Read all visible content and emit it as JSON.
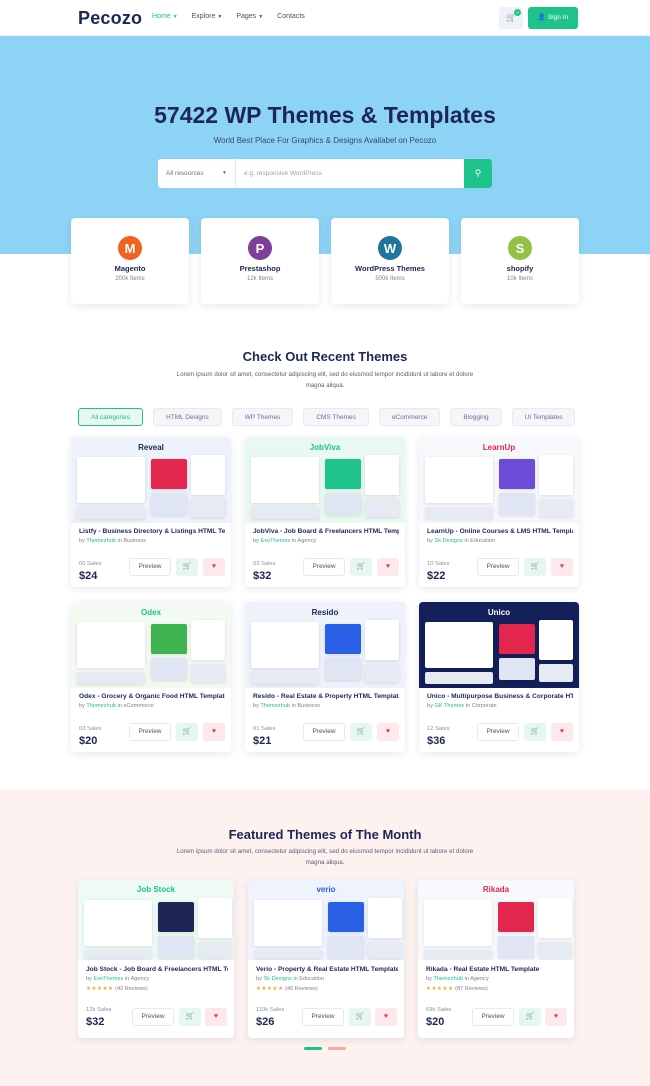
{
  "header": {
    "logo": "Pecozo",
    "nav": [
      {
        "label": "Home",
        "active": true
      },
      {
        "label": "Explore",
        "active": false
      },
      {
        "label": "Pages",
        "active": false
      },
      {
        "label": "Contacts",
        "active": false
      }
    ],
    "cart_count": "0",
    "signin_label": "Sign In"
  },
  "hero": {
    "title": "57422 WP Themes & Templates",
    "subtitle": "World Best Place For Graphics & Designs Availabel on Pecozo",
    "search": {
      "category": "All resources",
      "placeholder": "e.g. responsive WordPress"
    }
  },
  "categories": [
    {
      "name": "Magento",
      "count": "200k Items",
      "icon": "magento-icon",
      "color": "#f26322"
    },
    {
      "name": "Prestashop",
      "count": "12k Items",
      "icon": "prestashop-icon",
      "color": "#7e3f98"
    },
    {
      "name": "WordPress Themes",
      "count": "500k Items",
      "icon": "wordpress-icon",
      "color": "#21759b"
    },
    {
      "name": "shopify",
      "count": "10k Items",
      "icon": "shopify-icon",
      "color": "#95bf47"
    }
  ],
  "recent": {
    "title": "Check Out Recent Themes",
    "description": "Lorem ipsum dolor sit amet, consectetur adipiscing elit, sed do eiusmod tempor incididunt ut labore et dolore magna aliqua.",
    "filters": [
      "All categories",
      "HTML Designs",
      "WP Themes",
      "CMS Themes",
      "eCommerce",
      "Blogging",
      "UI Templates"
    ],
    "items": [
      {
        "title": "Listfy - Business Directory & Listings HTML Template",
        "by": "by",
        "author": "Themezhub",
        "in": "in",
        "category": "Business",
        "sales": "00 Sales",
        "price": "$24",
        "brand": "Reveal",
        "brand_color": "#1d2654",
        "bg": "#eef2fb",
        "accent": "#e2264d",
        "label_preview": "Preview"
      },
      {
        "title": "JobViva - Job Board & Freelancers HTML Template",
        "by": "by",
        "author": "ExoThemes",
        "in": "in",
        "category": "Agency",
        "sales": "03 Sales",
        "price": "$32",
        "brand": "JobViva",
        "brand_color": "#1ec28b",
        "bg": "#e9f9f1",
        "accent": "#1ec28b",
        "label_preview": "Preview"
      },
      {
        "title": "LearnUp - Online Courses & LMS HTML Template",
        "by": "by",
        "author": "Sk Designs",
        "in": "in",
        "category": "Education",
        "sales": "10 Sales",
        "price": "$22",
        "brand": "LearnUp",
        "brand_color": "#e2264d",
        "bg": "#f7f8fc",
        "accent": "#6b4bd8",
        "label_preview": "Preview"
      },
      {
        "title": "Odex - Grocery & Organic Food HTML Template",
        "by": "by",
        "author": "Themezhub",
        "in": "in",
        "category": "eCommerce",
        "sales": "03 Sales",
        "price": "$20",
        "brand": "Odex",
        "brand_color": "#1ec28b",
        "bg": "#f3faf2",
        "accent": "#3fb34f",
        "label_preview": "Preview"
      },
      {
        "title": "Resido - Real Estate & Property HTML Template",
        "by": "by",
        "author": "Themezhub",
        "in": "in",
        "category": "Business",
        "sales": "01 Sales",
        "price": "$21",
        "brand": "Resido",
        "brand_color": "#1d2654",
        "bg": "#eef2fb",
        "accent": "#2a60e6",
        "label_preview": "Preview"
      },
      {
        "title": "Unico - Multipurpose Business & Corporate HTML Template",
        "by": "by",
        "author": "GK Themes",
        "in": "in",
        "category": "Corporate",
        "sales": "12 Sales",
        "price": "$36",
        "brand": "Unico",
        "brand_color": "#ffffff",
        "bg": "#13205a",
        "accent": "#e2264d",
        "label_preview": "Preview"
      }
    ]
  },
  "featured": {
    "title": "Featured Themes of The Month",
    "description": "Lorem ipsum dolor sit amet, consectetur adipiscing elit, sed do eiusmod tempor incididunt ut labore et dolore magna aliqua.",
    "items": [
      {
        "title": "Job Stock - Job Board & Freelancers HTML Template",
        "by": "by",
        "author": "ExoThemes",
        "in": "in",
        "category": "Agency",
        "stars": "★★★★★",
        "reviews": "(42 Reviews)",
        "sales": "12k Sales",
        "price": "$32",
        "brand": "Job Stock",
        "brand_color": "#1ec28b",
        "bg": "#eefaf4",
        "accent": "#1d2654",
        "label_preview": "Preview"
      },
      {
        "title": "Verio - Property & Real Estate HTML Template",
        "by": "by",
        "author": "Sk Designs",
        "in": "in",
        "category": "Education",
        "stars": "★★★★★",
        "reviews": "(40 Reviews)",
        "sales": "110k Sales",
        "price": "$26",
        "brand": "verio",
        "brand_color": "#2a60e6",
        "bg": "#eef3fd",
        "accent": "#2a60e6",
        "label_preview": "Preview"
      },
      {
        "title": "Rikada - Real Estate HTML Template",
        "by": "by",
        "author": "Themezhub",
        "in": "in",
        "category": "Agency",
        "stars": "★★★★★",
        "reviews": "(87 Reviews)",
        "sales": "69k Sales",
        "price": "$20",
        "brand": "Rikada",
        "brand_color": "#e2264d",
        "bg": "#f8f9fc",
        "accent": "#e2264d",
        "label_preview": "Preview"
      }
    ]
  },
  "colors": {
    "accent": "#1ec28b",
    "hero_bg": "#8dd3f6",
    "navy": "#1d2654",
    "featured_bg": "#fdf2ef"
  }
}
